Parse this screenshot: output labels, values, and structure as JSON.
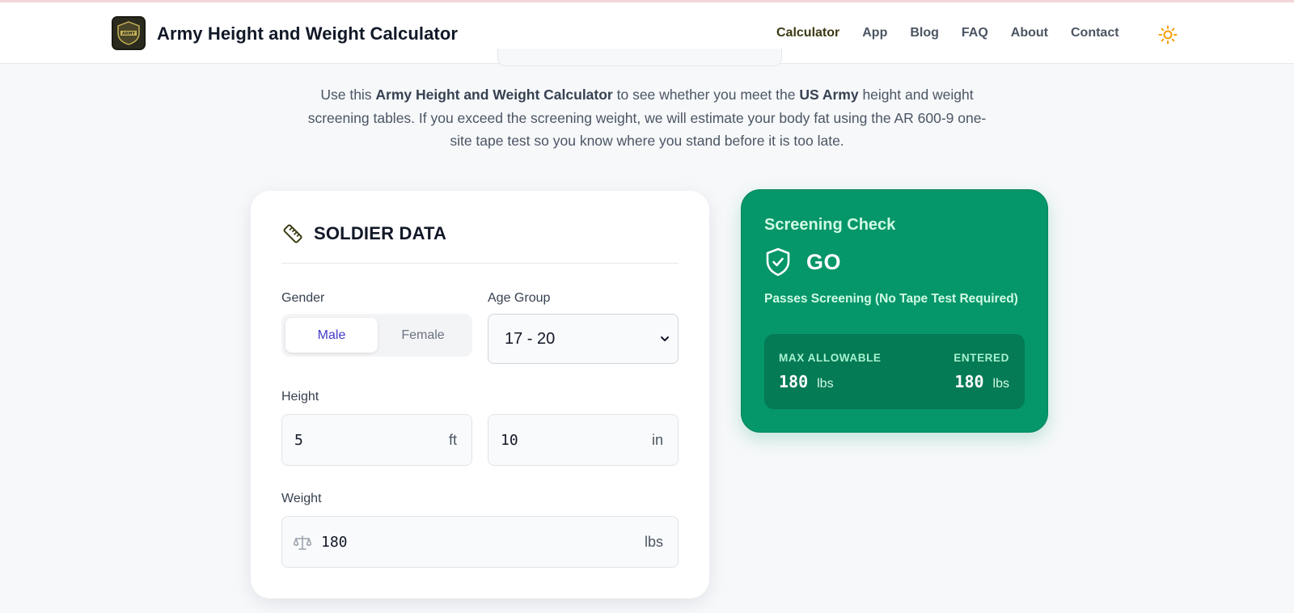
{
  "header": {
    "site_title": "Army Height and Weight Calculator",
    "logo_alt": "ARMY",
    "nav": [
      {
        "label": "Calculator",
        "active": true
      },
      {
        "label": "App"
      },
      {
        "label": "Blog"
      },
      {
        "label": "FAQ"
      },
      {
        "label": "About"
      },
      {
        "label": "Contact"
      }
    ],
    "theme_icon": "sun-icon"
  },
  "intro": {
    "p1": "Use this ",
    "b1": "Army Height and Weight Calculator",
    "p2": " to see whether you meet the ",
    "b2": "US Army",
    "p3": " height and weight screening tables. If you exceed the screening weight, we will estimate your body fat using the AR 600-9 one-site tape test so you know where you stand before it is too late."
  },
  "soldier_card": {
    "icon": "ruler-icon",
    "title": "SOLDIER DATA",
    "gender_label": "Gender",
    "gender_options": [
      "Male",
      "Female"
    ],
    "gender_selected": "Male",
    "age_label": "Age Group",
    "age_value": "17 - 20",
    "height_label": "Height",
    "height_ft": "5",
    "height_ft_unit": "ft",
    "height_in": "10",
    "height_in_unit": "in",
    "weight_label": "Weight",
    "weight_icon": "scale-icon",
    "weight_value": "180",
    "weight_unit": "lbs"
  },
  "screening": {
    "title": "Screening Check",
    "icon": "shield-check-icon",
    "result": "GO",
    "subtitle": "Passes Screening (No Tape Test Required)",
    "max_label": "MAX ALLOWABLE",
    "max_value": "180",
    "max_unit": "lbs",
    "entered_label": "ENTERED",
    "entered_value": "180",
    "entered_unit": "lbs"
  },
  "colors": {
    "accent_go": "#059669",
    "nav_active": "#3b3a14",
    "selected_segment": "#4338ca",
    "theme_icon": "#f59e0b"
  }
}
